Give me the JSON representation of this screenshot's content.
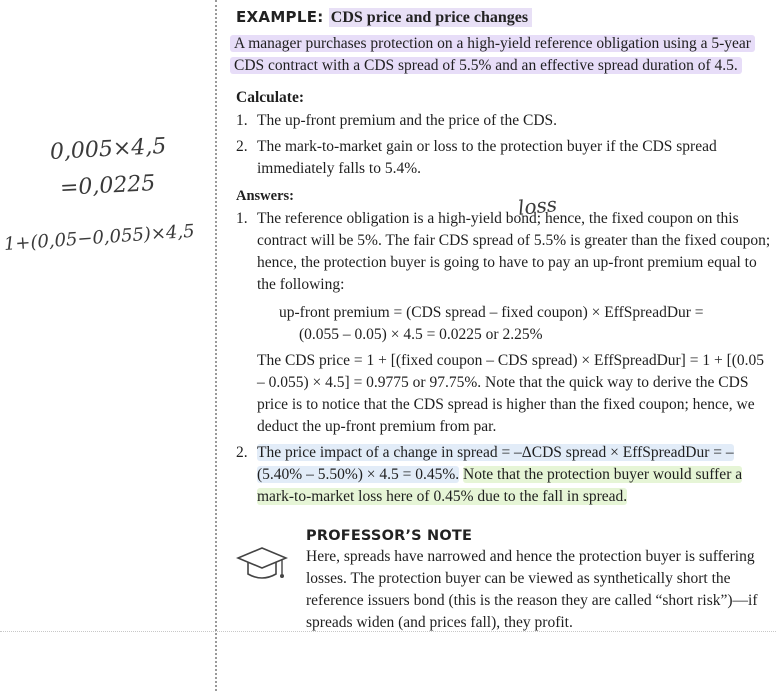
{
  "example": {
    "label": "EXAMPLE:",
    "title": "CDS price and price changes",
    "intro": "A manager purchases protection on a high-yield reference obligation using a 5-year CDS contract with a CDS spread of 5.5% and an effective spread duration of 4.5."
  },
  "calculate": {
    "heading": "Calculate:",
    "items": [
      {
        "num": "1.",
        "text": "The up-front premium and the price of the CDS."
      },
      {
        "num": "2.",
        "text": "The mark-to-market gain or loss to the protection buyer if the CDS spread immediately falls to 5.4%."
      }
    ]
  },
  "answers": {
    "heading": "Answers:",
    "a1": {
      "num": "1.",
      "text": "The reference obligation is a high-yield bond; hence, the fixed coupon on this contract will be 5%. The fair CDS spread of 5.5% is greater than the fixed coupon; hence, the protection buyer is going to have to pay an up-front premium equal to the following:",
      "formula_line1": "up-front premium = (CDS spread – fixed coupon) × EffSpreadDur =",
      "formula_line2": "(0.055 – 0.05) × 4.5 = 0.0225 or 2.25%",
      "price_text": "The CDS price = 1 + [(fixed coupon – CDS spread) × EffSpreadDur] = 1 + [(0.05 – 0.055) × 4.5] = 0.9775 or 97.75%. Note that the quick way to derive the CDS price is to notice that the CDS spread is higher than the fixed coupon; hence, we deduct the up-front premium from par."
    },
    "a2": {
      "num": "2.",
      "text_blue": "The price impact of a change in spread = –ΔCDS spread × EffSpreadDur = –(5.40% – 5.50%) × 4.5 = 0.45%.",
      "text_green": "Note that the protection buyer would suffer a mark-to-market loss here of 0.45% due to the fall in spread."
    }
  },
  "professor_note": {
    "heading": "PROFESSOR’S NOTE",
    "icon": "graduation-cap-icon",
    "text": "Here, spreads have narrowed and hence the protection buyer is suffering losses. The protection buyer can be viewed as synthetically short the reference issuers bond (this is the reason they are called “short risk”)—if spreads widen (and prices fall), they profit."
  },
  "handwritten": {
    "line1": "0,005×4,5",
    "line2": "=0,0225",
    "line3": "1+(0,05−0,055)×4,5",
    "loss": "loss"
  },
  "colors": {
    "highlight_purple": "#e7ddf8",
    "highlight_blue": "#e2ecf8",
    "highlight_green": "#e6f5d6"
  }
}
